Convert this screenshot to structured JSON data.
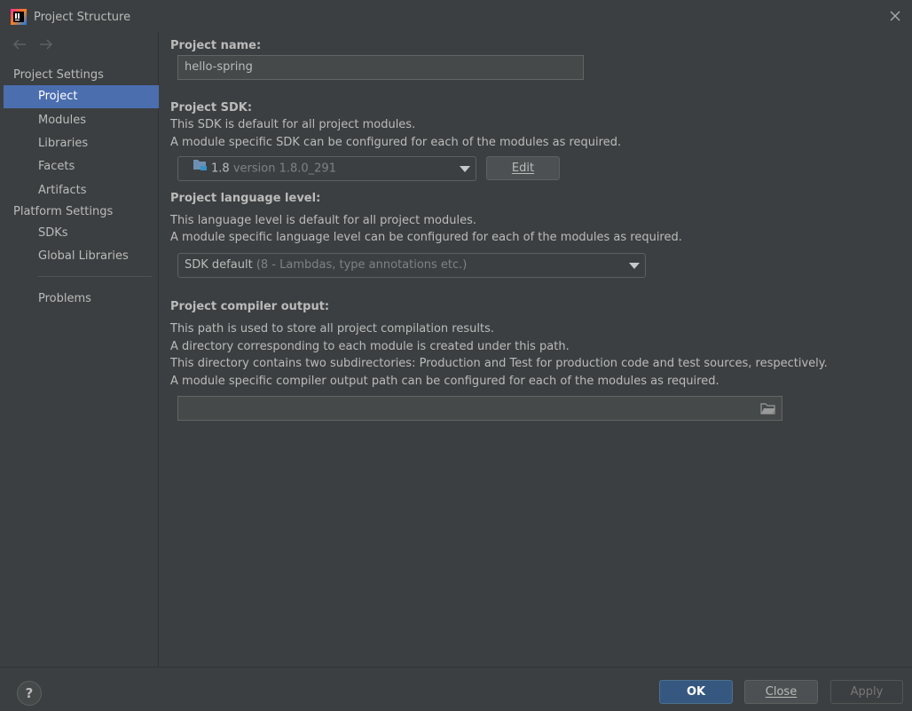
{
  "window": {
    "title": "Project Structure",
    "app_icon": "intellij-idea-icon",
    "close_icon": "close-icon"
  },
  "sidebar": {
    "nav": {
      "back_icon": "arrow-left-icon",
      "forward_icon": "arrow-right-icon"
    },
    "project_settings_header": "Project Settings",
    "project_settings_items": [
      "Project",
      "Modules",
      "Libraries",
      "Facets",
      "Artifacts"
    ],
    "platform_settings_header": "Platform Settings",
    "platform_settings_items": [
      "SDKs",
      "Global Libraries"
    ],
    "problems_label": "Problems",
    "selected": "Project"
  },
  "main": {
    "project_name": {
      "label": "Project name:",
      "value": "hello-spring"
    },
    "project_sdk": {
      "label": "Project SDK:",
      "desc_line1": "This SDK is default for all project modules.",
      "desc_line2": "A module specific SDK can be configured for each of the modules as required.",
      "selected_name": "1.8",
      "selected_version": "version 1.8.0_291",
      "sdk_icon": "folder-sdk-icon",
      "edit_button": "Edit"
    },
    "language_level": {
      "label": "Project language level:",
      "desc_line1": "This language level is default for all project modules.",
      "desc_line2": "A module specific language level can be configured for each of the modules as required.",
      "selected_name": "SDK default",
      "selected_detail": "(8 - Lambdas, type annotations etc.)"
    },
    "compiler_output": {
      "label": "Project compiler output:",
      "desc_line1": "This path is used to store all project compilation results.",
      "desc_line2": "A directory corresponding to each module is created under this path.",
      "desc_line3": "This directory contains two subdirectories: Production and Test for production code and test sources, respectively.",
      "desc_line4": "A module specific compiler output path can be configured for each of the modules as required.",
      "value": "",
      "browse_icon": "folder-browse-icon"
    }
  },
  "footer": {
    "help_label": "?",
    "ok_button": "OK",
    "close_button": "Close",
    "apply_button": "Apply"
  },
  "colors": {
    "background": "#3c3f41",
    "selection": "#4b6eaf",
    "primary_button": "#365880",
    "field": "#45494a"
  }
}
